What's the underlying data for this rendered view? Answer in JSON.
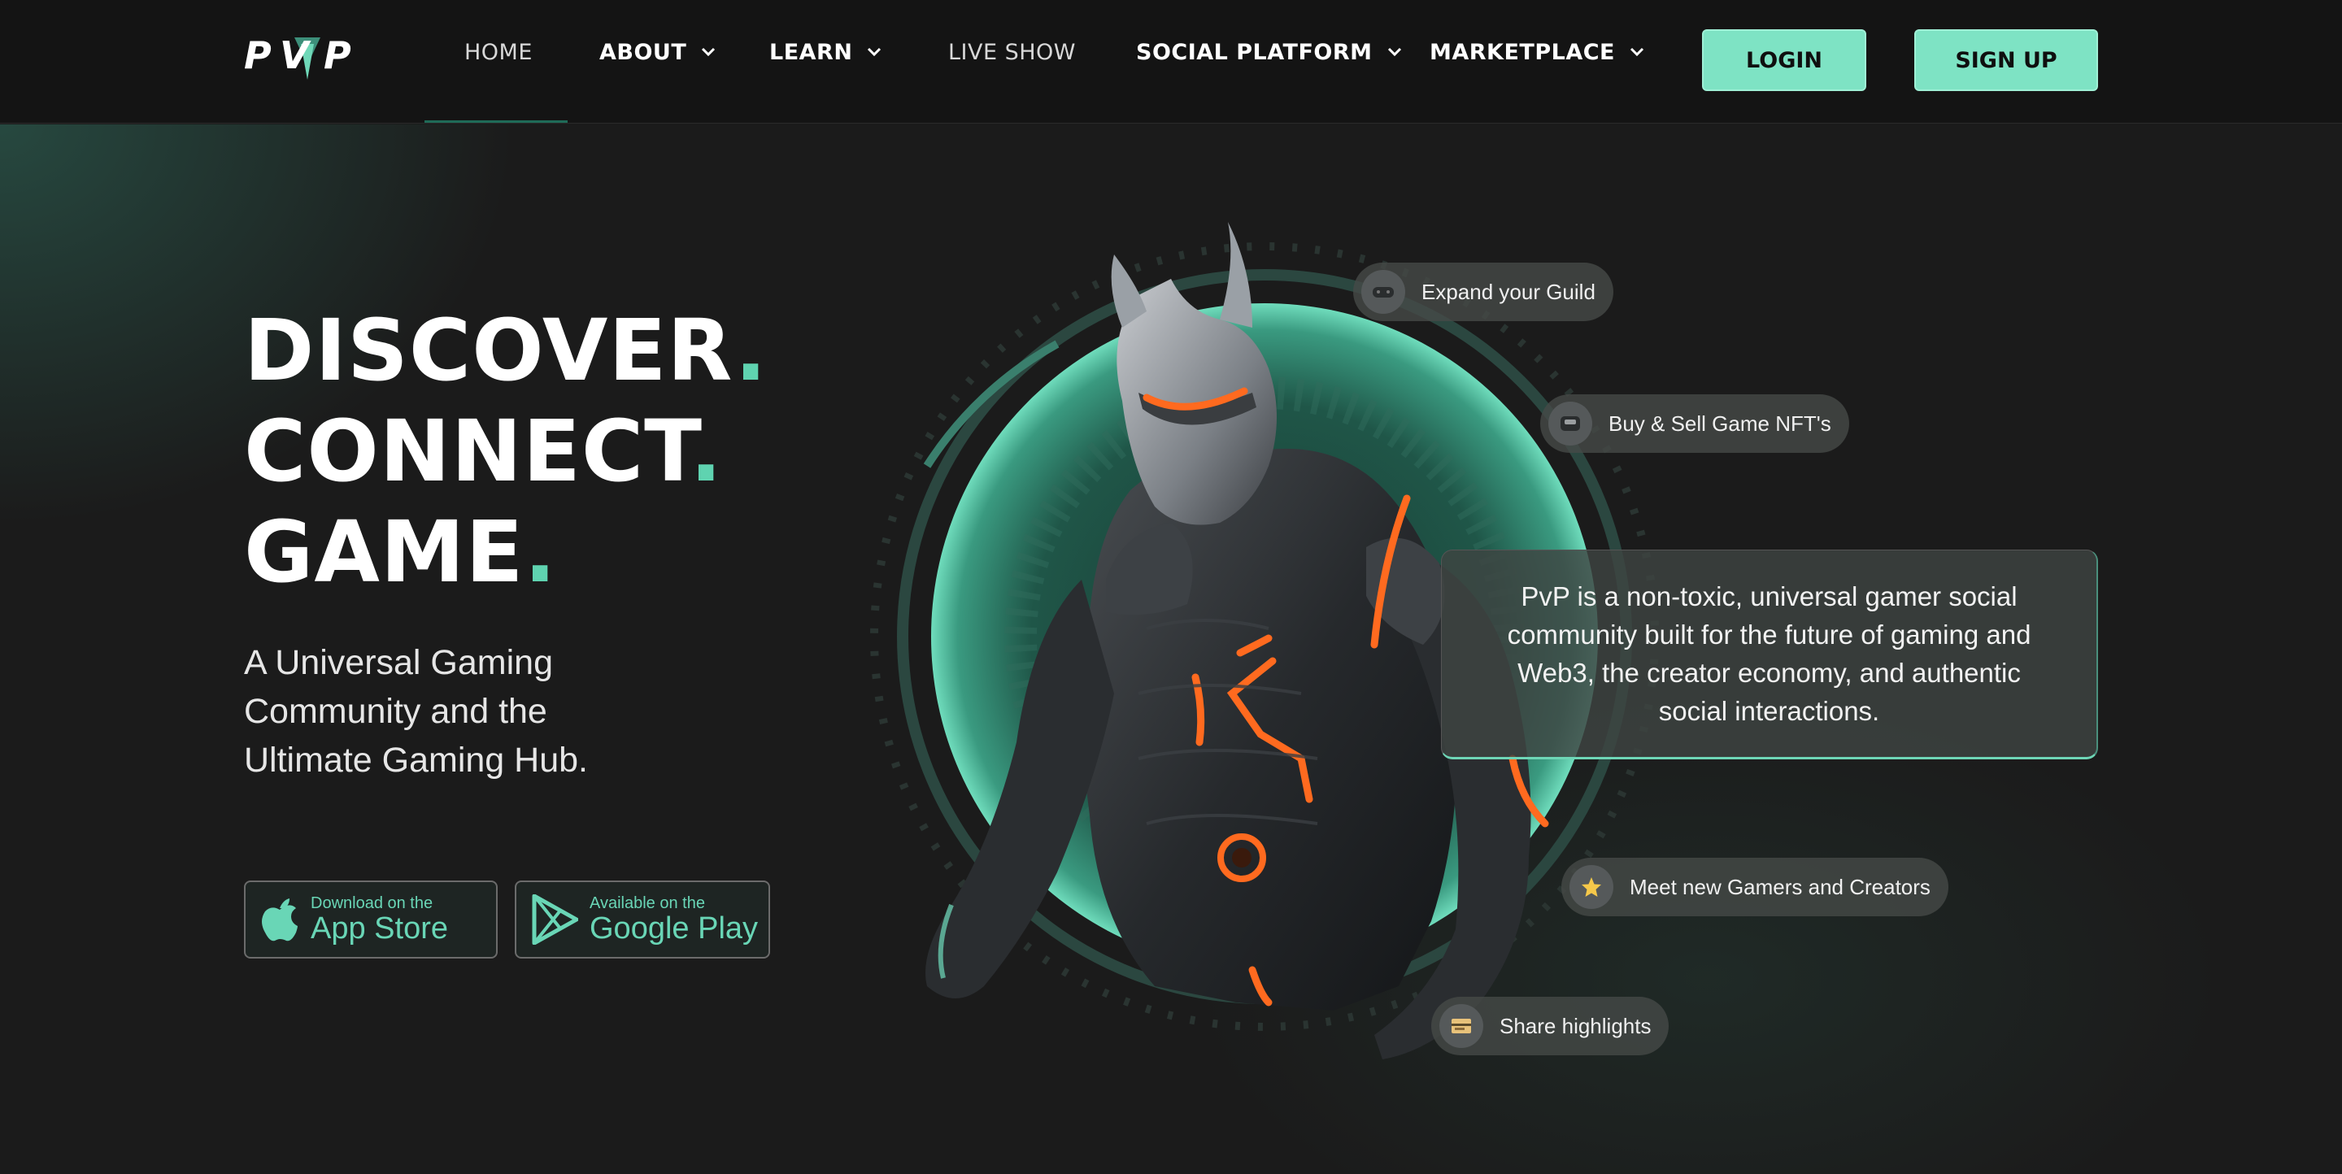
{
  "nav": {
    "logo_text": "PVP",
    "items": [
      {
        "label": "HOME",
        "has_dropdown": false,
        "active": true
      },
      {
        "label": "ABOUT",
        "has_dropdown": true
      },
      {
        "label": "LEARN",
        "has_dropdown": true
      },
      {
        "label": "LIVE SHOW",
        "has_dropdown": false
      },
      {
        "label": "SOCIAL PLATFORM",
        "has_dropdown": true
      },
      {
        "label": "MARKETPLACE",
        "has_dropdown": true
      }
    ],
    "login_label": "LOGIN",
    "signup_label": "SIGN UP"
  },
  "hero": {
    "headline": [
      {
        "word": "DISCOVER",
        "dot": "."
      },
      {
        "word": "CONNECT",
        "dot": "."
      },
      {
        "word": "GAME",
        "dot": "."
      }
    ],
    "subtitle": "A Universal Gaming Community and the Ultimate Gaming Hub.",
    "stores": {
      "app_store": {
        "small": "Download on the",
        "big": "App Store",
        "icon": "apple-icon"
      },
      "google_play": {
        "small": "Available on the",
        "big": "Google Play",
        "icon": "google-play-icon"
      }
    }
  },
  "features": {
    "expand_guild": {
      "label": "Expand your Guild",
      "icon": "gamepad-icon"
    },
    "buy_sell_nft": {
      "label": "Buy & Sell Game NFT's",
      "icon": "controller-icon"
    },
    "meet_gamers": {
      "label": "Meet new Gamers and Creators",
      "icon": "star-icon"
    },
    "share_highlights": {
      "label": "Share highlights",
      "icon": "film-icon"
    }
  },
  "description": "PvP is a non-toxic, universal gamer social community built for the future of gaming and Web3, the creator economy, and authentic social interactions.",
  "colors": {
    "accent": "#7ee3c4",
    "accent_dark": "#5fd3b0",
    "background": "#1b1b1b",
    "nav_background": "#141414",
    "character_glow": "#ff6a1f"
  }
}
